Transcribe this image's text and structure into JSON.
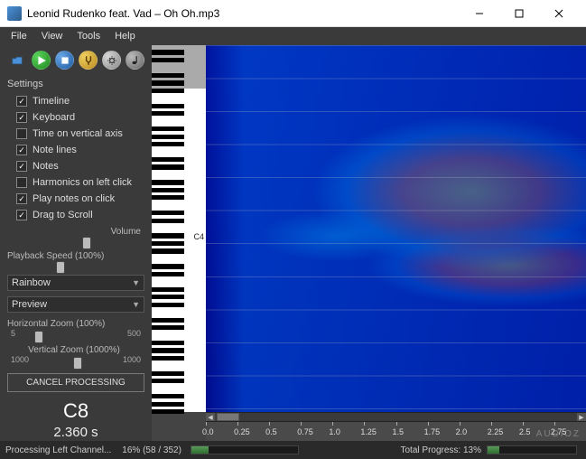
{
  "window": {
    "title": "Leonid Rudenko feat. Vad – Oh Oh.mp3"
  },
  "menu": {
    "items": [
      "File",
      "View",
      "Tools",
      "Help"
    ]
  },
  "toolbar_icons": [
    "open-folder",
    "play",
    "stop",
    "tool-a",
    "tool-b",
    "tool-c"
  ],
  "settings": {
    "label": "Settings",
    "checks": [
      {
        "label": "Timeline",
        "checked": true
      },
      {
        "label": "Keyboard",
        "checked": true
      },
      {
        "label": "Time on vertical axis",
        "checked": false
      },
      {
        "label": "Note lines",
        "checked": true
      },
      {
        "label": "Notes",
        "checked": true
      },
      {
        "label": "Harmonics on left click",
        "checked": false
      },
      {
        "label": "Play notes on click",
        "checked": true
      },
      {
        "label": "Drag to Scroll",
        "checked": true
      }
    ],
    "volume_label": "Volume",
    "playback_label": "Playback Speed (100%)",
    "colormap": "Rainbow",
    "preview": "Preview",
    "hzoom_label": "Horizontal Zoom (100%)",
    "hzoom_min": "5",
    "hzoom_max": "500",
    "vzoom_label": "Vertical Zoom (1000%)",
    "vzoom_min": "1000",
    "vzoom_max": "1000",
    "cancel_label": "CANCEL PROCESSING"
  },
  "readout": {
    "note": "C8",
    "time": "2.360 s"
  },
  "keyboard": {
    "c4_label": "C4"
  },
  "ruler": {
    "ticks": [
      "0.0",
      "0.25",
      "0.5",
      "0.75",
      "1.0",
      "1.25",
      "1.5",
      "1.75",
      "2.0",
      "2.25",
      "2.5",
      "2.75"
    ]
  },
  "status": {
    "left_text": "Processing Left Channel...",
    "left_pct_text": "16% (58 / 352)",
    "total_text": "Total Progress: 13%"
  },
  "watermark": "AUDiOZ"
}
